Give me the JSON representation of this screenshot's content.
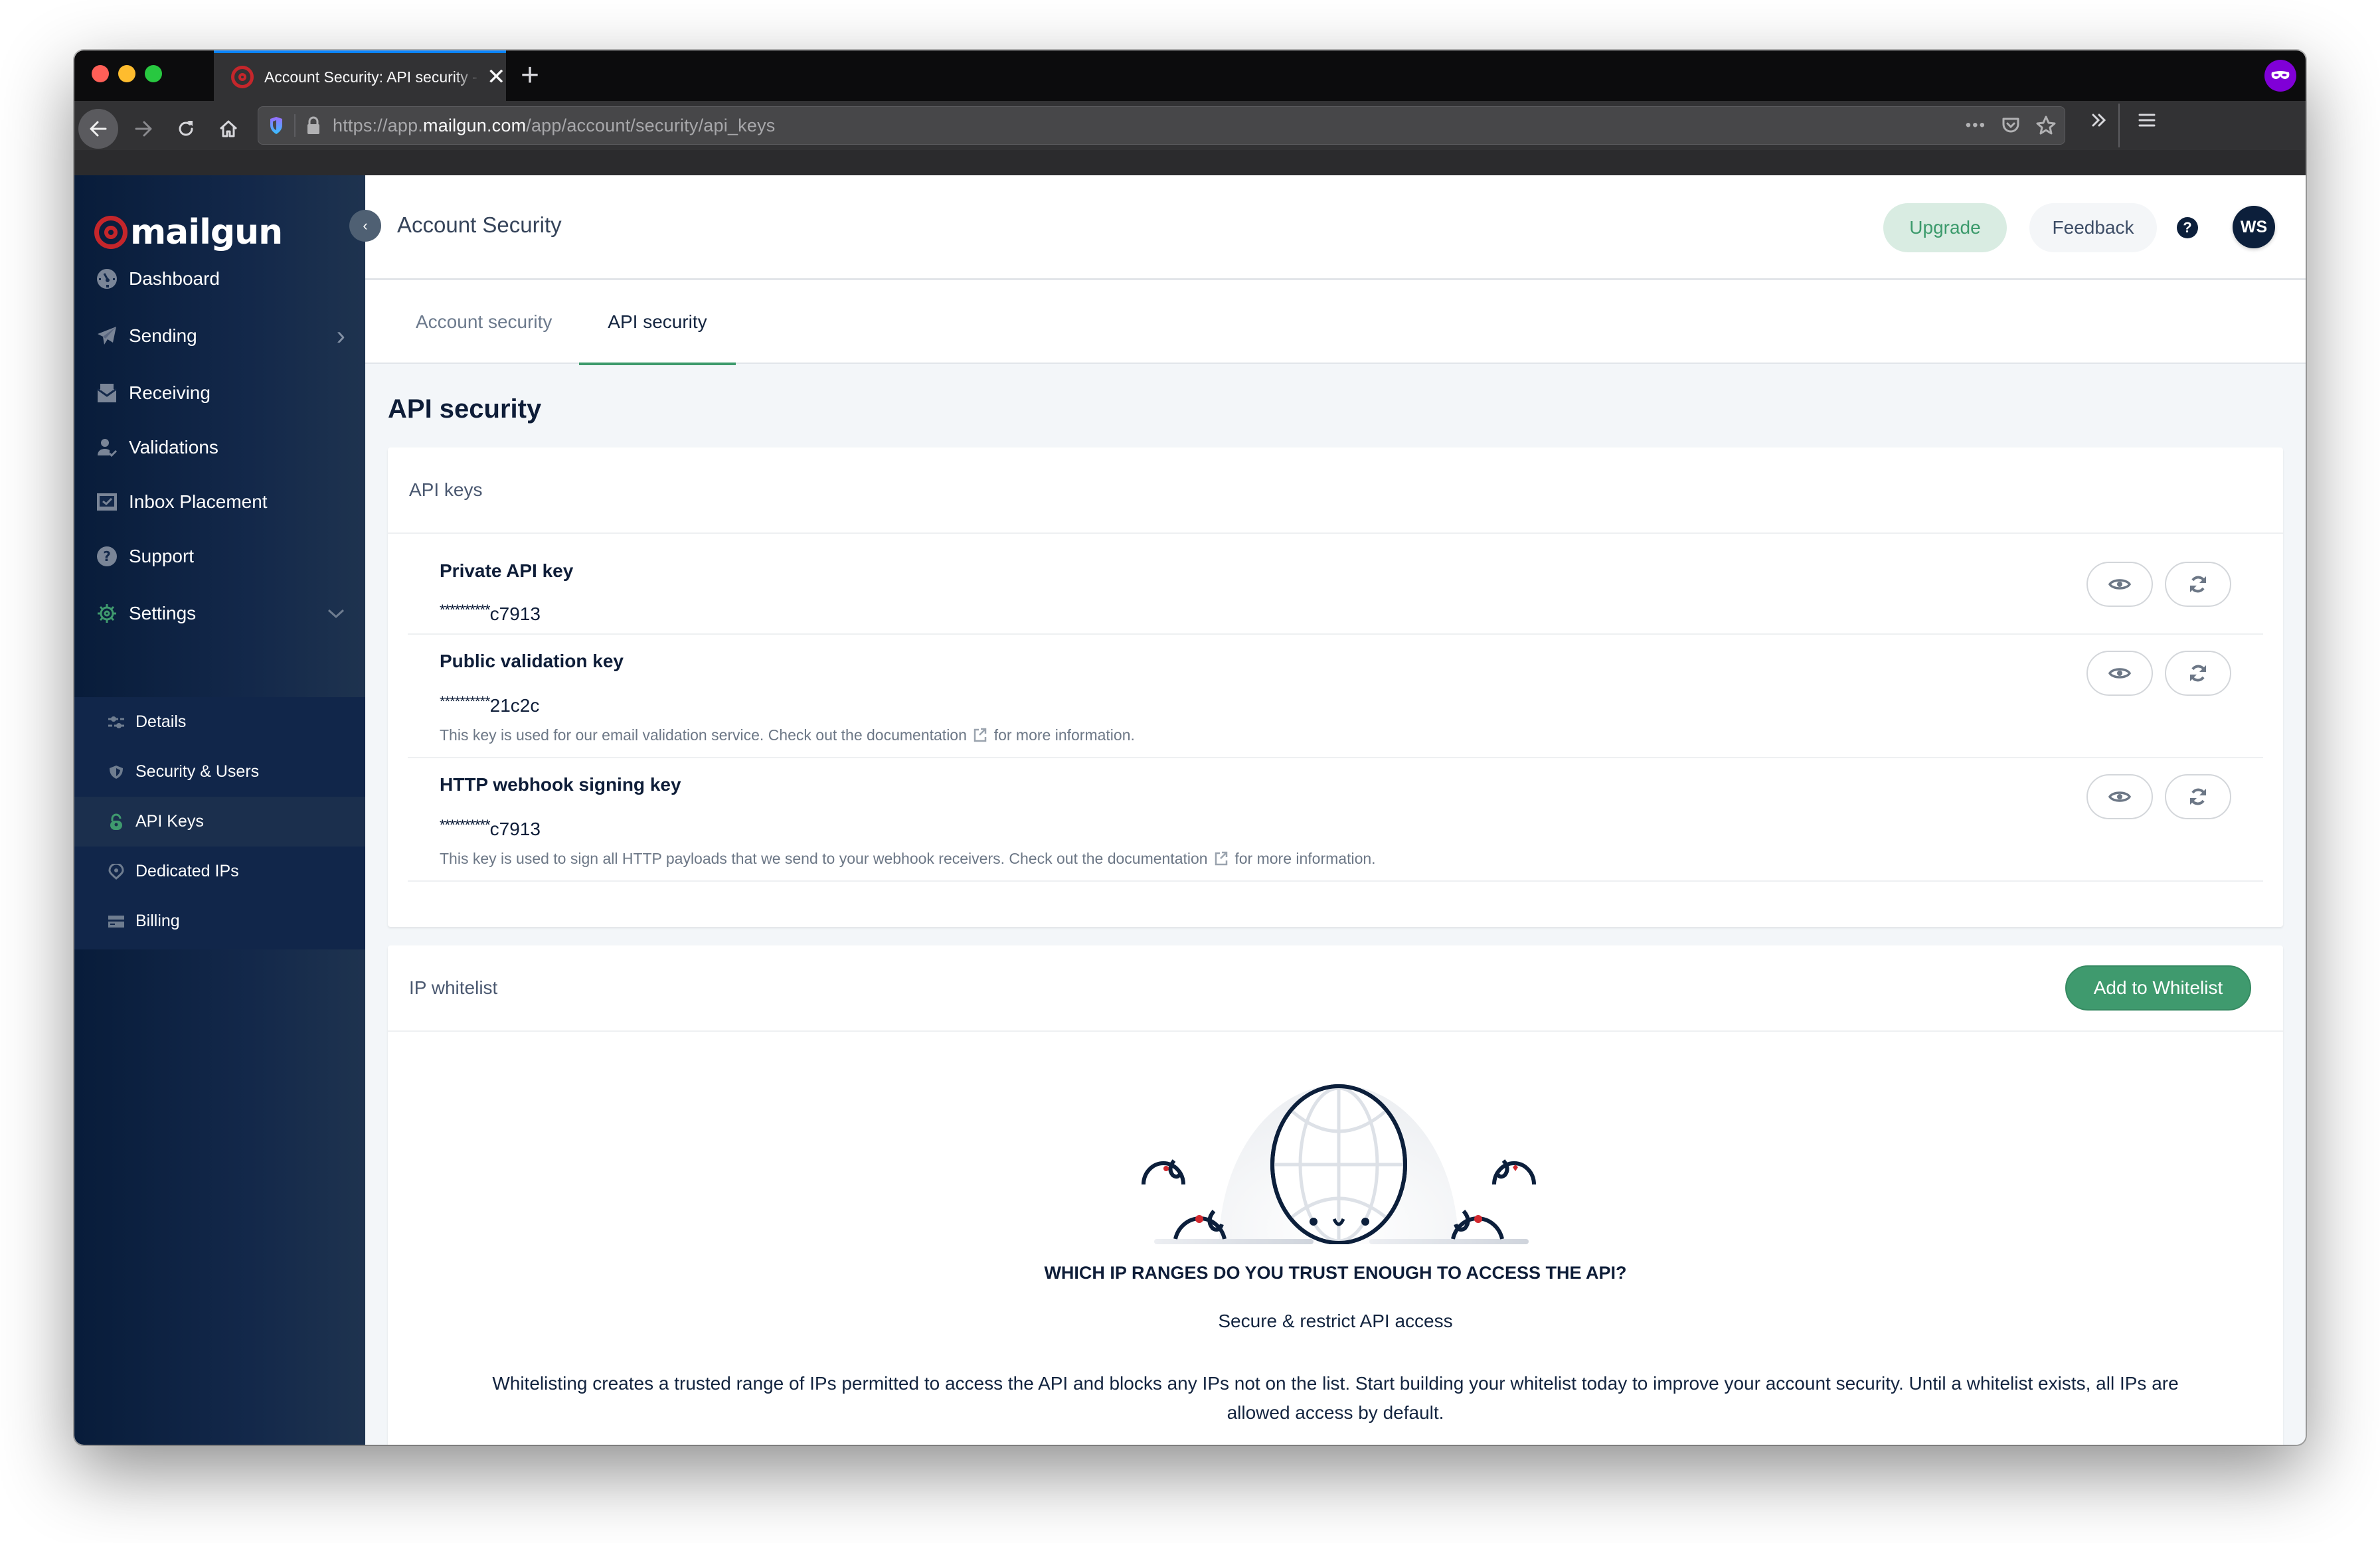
{
  "browser": {
    "tab_title": "Account Security: API security - Mailgun",
    "tab_close": "✕",
    "new_tab": "+",
    "url_prefix": "https://app.",
    "url_domain": "mailgun.com",
    "url_path": "/app/account/security/api_keys",
    "url_more": "•••"
  },
  "sidebar": {
    "brand": "mailgun",
    "collapse_label": "‹",
    "items": [
      {
        "label": "Dashboard",
        "icon": "dashboard-icon"
      },
      {
        "label": "Sending",
        "icon": "paper-plane-icon",
        "chevron": "›"
      },
      {
        "label": "Receiving",
        "icon": "inbox-icon"
      },
      {
        "label": "Validations",
        "icon": "user-check-icon"
      },
      {
        "label": "Inbox Placement",
        "icon": "inbox-placement-icon"
      },
      {
        "label": "Support",
        "icon": "help-circle-icon"
      },
      {
        "label": "Settings",
        "icon": "gear-icon",
        "chevron": "⌄"
      }
    ],
    "settings_subitems": [
      {
        "label": "Details",
        "icon": "sliders-icon"
      },
      {
        "label": "Security & Users",
        "icon": "shield-icon"
      },
      {
        "label": "API Keys",
        "icon": "lock-icon",
        "active": true
      },
      {
        "label": "Dedicated IPs",
        "icon": "location-pin-icon"
      },
      {
        "label": "Billing",
        "icon": "credit-card-icon"
      }
    ]
  },
  "header": {
    "title": "Account Security",
    "upgrade_label": "Upgrade",
    "feedback_label": "Feedback",
    "help_label": "?",
    "avatar_initials": "WS"
  },
  "tabs": [
    {
      "label": "Account security",
      "active": false
    },
    {
      "label": "API security",
      "active": true
    }
  ],
  "page": {
    "section_title": "API security",
    "api_keys": {
      "card_title": "API keys",
      "keys": [
        {
          "name": "Private API key",
          "mask": "**********",
          "suffix": "c7913",
          "description": null
        },
        {
          "name": "Public validation key",
          "mask": "**********",
          "suffix": "21c2c",
          "description_before": "This key is used for our email validation service. Check out the documentation",
          "description_after": "for more information."
        },
        {
          "name": "HTTP webhook signing key",
          "mask": "**********",
          "suffix": "c7913",
          "description_before": "This key is used to sign all HTTP payloads that we send to your webhook receivers. Check out the documentation",
          "description_after": "for more information."
        }
      ]
    },
    "ip_whitelist": {
      "card_title": "IP whitelist",
      "add_button": "Add to Whitelist",
      "heading": "WHICH IP RANGES DO YOU TRUST ENOUGH TO ACCESS THE API?",
      "subheading": "Secure & restrict API access",
      "body": "Whitelisting creates a trusted range of IPs permitted to access the API and blocks any IPs not on the list. Start building your whitelist today to improve your account security. Until a whitelist exists, all IPs are allowed access by default."
    }
  },
  "colors": {
    "brand_red": "#c5262b",
    "accent_green": "#3f9a6e",
    "sidebar_navy": "#0c1f3b",
    "private_purple": "#8000d7"
  }
}
